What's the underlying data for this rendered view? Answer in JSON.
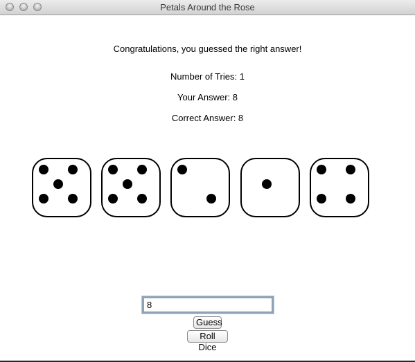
{
  "window": {
    "title": "Petals Around the Rose"
  },
  "messages": {
    "result": "Congratulations, you guessed the right answer!",
    "tries": "Number of Tries: 1",
    "your_answer": "Your Answer: 8",
    "correct_answer": "Correct Answer: 8"
  },
  "dice": [
    5,
    5,
    2,
    1,
    4
  ],
  "input": {
    "guess_value": "8"
  },
  "buttons": {
    "guess": "Guess",
    "roll": "Roll Dice"
  }
}
